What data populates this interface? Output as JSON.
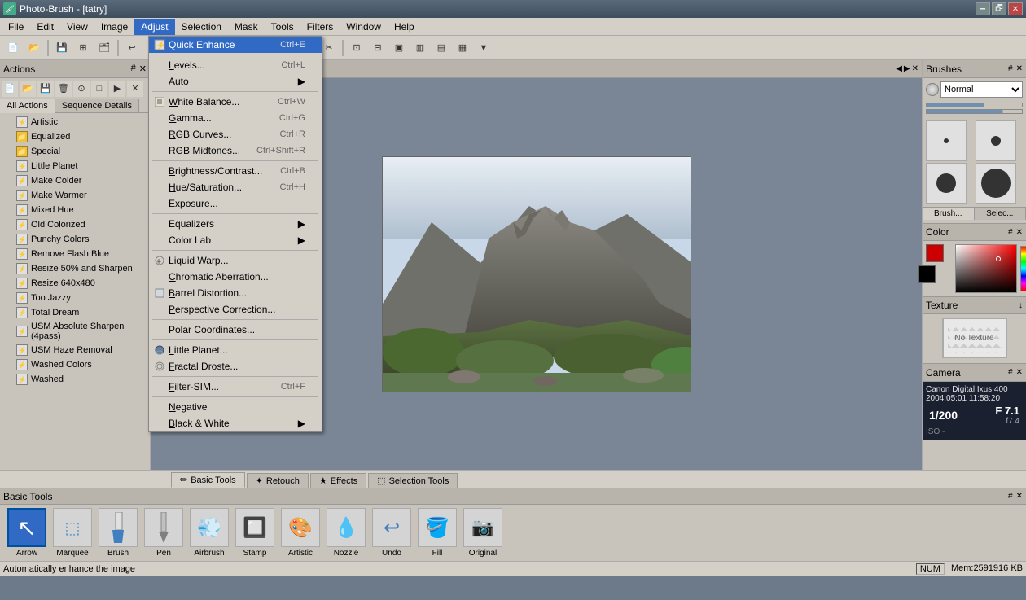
{
  "app": {
    "title": "Photo-Brush - [tatry]",
    "icon": "🖌"
  },
  "titlebar": {
    "minimize": "🗕",
    "maximize": "🗗",
    "close": "✕"
  },
  "menubar": {
    "items": [
      "File",
      "Edit",
      "View",
      "Image",
      "Adjust",
      "Selection",
      "Mask",
      "Tools",
      "Filters",
      "Window",
      "Help"
    ]
  },
  "adjust_menu": {
    "items": [
      {
        "label": "Quick Enhance",
        "shortcut": "Ctrl+E",
        "highlighted": true,
        "icon": "⚡"
      },
      {
        "label": "",
        "sep": true
      },
      {
        "label": "Levels...",
        "shortcut": "Ctrl+L"
      },
      {
        "label": "Auto",
        "arrow": true
      },
      {
        "label": "",
        "sep": true
      },
      {
        "label": "White Balance...",
        "shortcut": "Ctrl+W",
        "icon": "⊞"
      },
      {
        "label": "Gamma...",
        "shortcut": "Ctrl+G"
      },
      {
        "label": "RGB Curves...",
        "shortcut": "Ctrl+R"
      },
      {
        "label": "RGB Midtones...",
        "shortcut": "Ctrl+Shift+R"
      },
      {
        "label": "",
        "sep": true
      },
      {
        "label": "Brightness/Contrast...",
        "shortcut": "Ctrl+B"
      },
      {
        "label": "Hue/Saturation...",
        "shortcut": "Ctrl+H"
      },
      {
        "label": "Exposure..."
      },
      {
        "label": "",
        "sep": true
      },
      {
        "label": "Equalizers",
        "arrow": true
      },
      {
        "label": "Color Lab",
        "arrow": true
      },
      {
        "label": "",
        "sep": true
      },
      {
        "label": "Liquid Warp...",
        "icon": "◈"
      },
      {
        "label": "Chromatic Aberration..."
      },
      {
        "label": "Barrel Distortion..."
      },
      {
        "label": "Perspective Correction..."
      },
      {
        "label": "",
        "sep": true
      },
      {
        "label": "Polar Coordinates..."
      },
      {
        "label": "",
        "sep": true
      },
      {
        "label": "Little Planet...",
        "icon": "🌐"
      },
      {
        "label": "Fractal Droste..."
      },
      {
        "label": "",
        "sep": true
      },
      {
        "label": "Filter-SIM...",
        "shortcut": "Ctrl+F"
      },
      {
        "label": "",
        "sep": true
      },
      {
        "label": "Negative"
      },
      {
        "label": "Black & White",
        "arrow": true
      }
    ]
  },
  "actions": {
    "title": "Actions",
    "pin": "#",
    "tabs": [
      "All Actions",
      "Sequence Details"
    ],
    "active_tab": 0,
    "items": [
      {
        "label": "Artistic",
        "type": "lightning"
      },
      {
        "label": "Equalized",
        "type": "folder"
      },
      {
        "label": "Special",
        "type": "folder"
      },
      {
        "label": "Little Planet",
        "type": "lightning"
      },
      {
        "label": "Make Colder",
        "type": "lightning"
      },
      {
        "label": "Make Warmer",
        "type": "lightning"
      },
      {
        "label": "Mixed Hue",
        "type": "lightning"
      },
      {
        "label": "Old Colorized",
        "type": "lightning"
      },
      {
        "label": "Punchy Colors",
        "type": "lightning"
      },
      {
        "label": "Remove Flash Blue",
        "type": "lightning"
      },
      {
        "label": "Resize 50% and Sharpen",
        "type": "lightning"
      },
      {
        "label": "Resize 640x480",
        "type": "lightning"
      },
      {
        "label": "Too Jazzy",
        "type": "lightning"
      },
      {
        "label": "Total Dream",
        "type": "lightning"
      },
      {
        "label": "USM Absolute Sharpen (4pass)",
        "type": "lightning"
      },
      {
        "label": "USM Haze Removal",
        "type": "lightning"
      },
      {
        "label": "Washed Colors",
        "type": "lightning"
      },
      {
        "label": "Washed",
        "type": "lightning"
      }
    ]
  },
  "canvas": {
    "nav_buttons": [
      "◀",
      "▶",
      "✕"
    ]
  },
  "brushes": {
    "title": "Brushes",
    "pin": "#",
    "mode": "Normal",
    "tabs": [
      "Brush...",
      "Selec..."
    ]
  },
  "color_panel": {
    "title": "Color",
    "pin": "#"
  },
  "texture_panel": {
    "title": "Texture",
    "no_texture": "No Texture"
  },
  "camera_panel": {
    "title": "Camera",
    "pin": "#",
    "model": "Canon Digital Ixus 400",
    "date": "2004:05:01 11:58:20",
    "shutter": "1/200",
    "f_prefix": "F",
    "aperture": "7.1",
    "iso_label": "ISO -",
    "focal": "f7.4"
  },
  "basic_tools": {
    "title": "Basic Tools",
    "pin": "#",
    "tools": [
      {
        "label": "Arrow",
        "icon": "↖",
        "active": true
      },
      {
        "label": "Marquee",
        "icon": "⬚"
      },
      {
        "label": "Brush",
        "icon": "🖌"
      },
      {
        "label": "Pen",
        "icon": "✒"
      },
      {
        "label": "Airbrush",
        "icon": "💨"
      },
      {
        "label": "Stamp",
        "icon": "🔲"
      },
      {
        "label": "Artistic",
        "icon": "🎨"
      },
      {
        "label": "Nozzle",
        "icon": "💧"
      },
      {
        "label": "Undo",
        "icon": "↩"
      },
      {
        "label": "Fill",
        "icon": "🪣"
      },
      {
        "label": "Original",
        "icon": "📷"
      }
    ]
  },
  "bottom_tabs": [
    {
      "label": "Basic Tools",
      "active": true,
      "icon": "✏"
    },
    {
      "label": "Retouch",
      "icon": "✦"
    },
    {
      "label": "Effects",
      "icon": "★"
    },
    {
      "label": "Selection Tools",
      "icon": "⬚"
    }
  ],
  "status": {
    "message": "Automatically enhance the image",
    "num": "NUM",
    "memory": "Mem:2591916 KB"
  }
}
